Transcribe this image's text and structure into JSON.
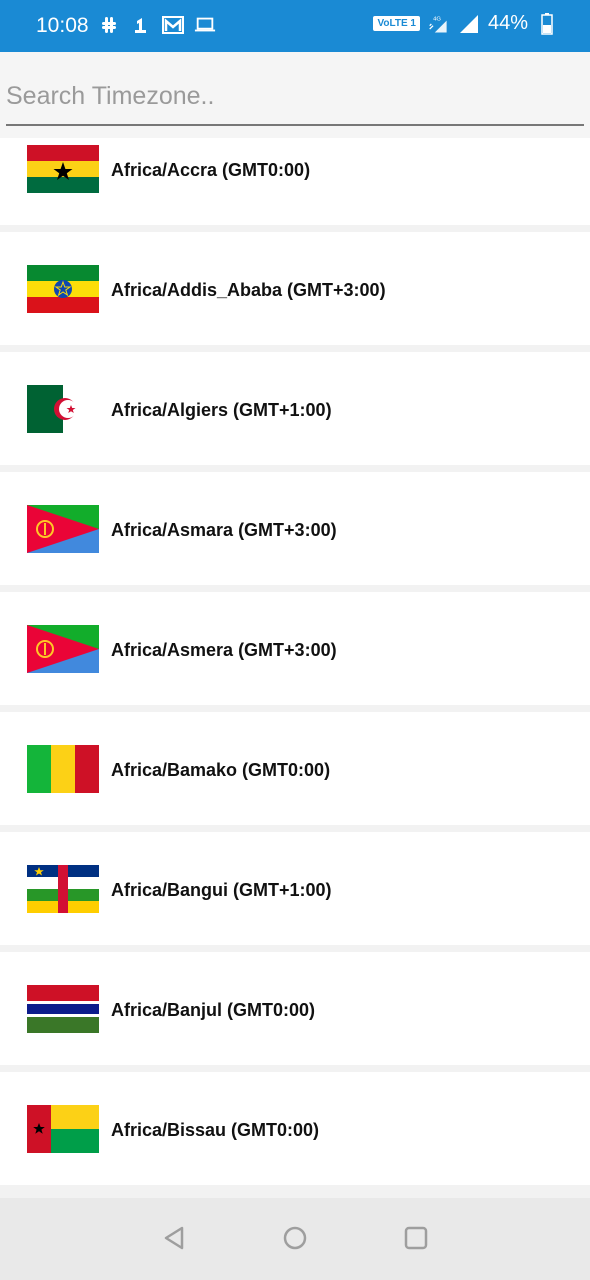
{
  "status_bar": {
    "time": "10:08",
    "network_badge": "VoLTE 1",
    "network_type": "4G",
    "battery_percent": "44%"
  },
  "search": {
    "placeholder": "Search Timezone..",
    "value": ""
  },
  "timezones": [
    {
      "label": "Africa/Accra (GMT0:00)",
      "flag_icon": "ghana-flag-icon"
    },
    {
      "label": "Africa/Addis_Ababa (GMT+3:00)",
      "flag_icon": "ethiopia-flag-icon"
    },
    {
      "label": "Africa/Algiers (GMT+1:00)",
      "flag_icon": "algeria-flag-icon"
    },
    {
      "label": "Africa/Asmara (GMT+3:00)",
      "flag_icon": "eritrea-flag-icon"
    },
    {
      "label": "Africa/Asmera (GMT+3:00)",
      "flag_icon": "eritrea-flag-icon"
    },
    {
      "label": "Africa/Bamako (GMT0:00)",
      "flag_icon": "mali-flag-icon"
    },
    {
      "label": "Africa/Bangui (GMT+1:00)",
      "flag_icon": "central-african-republic-flag-icon"
    },
    {
      "label": "Africa/Banjul (GMT0:00)",
      "flag_icon": "gambia-flag-icon"
    },
    {
      "label": "Africa/Bissau (GMT0:00)",
      "flag_icon": "guinea-bissau-flag-icon"
    }
  ],
  "colors": {
    "status_bar": "#1a8ad4",
    "nav_bar": "#e9e9e9"
  }
}
